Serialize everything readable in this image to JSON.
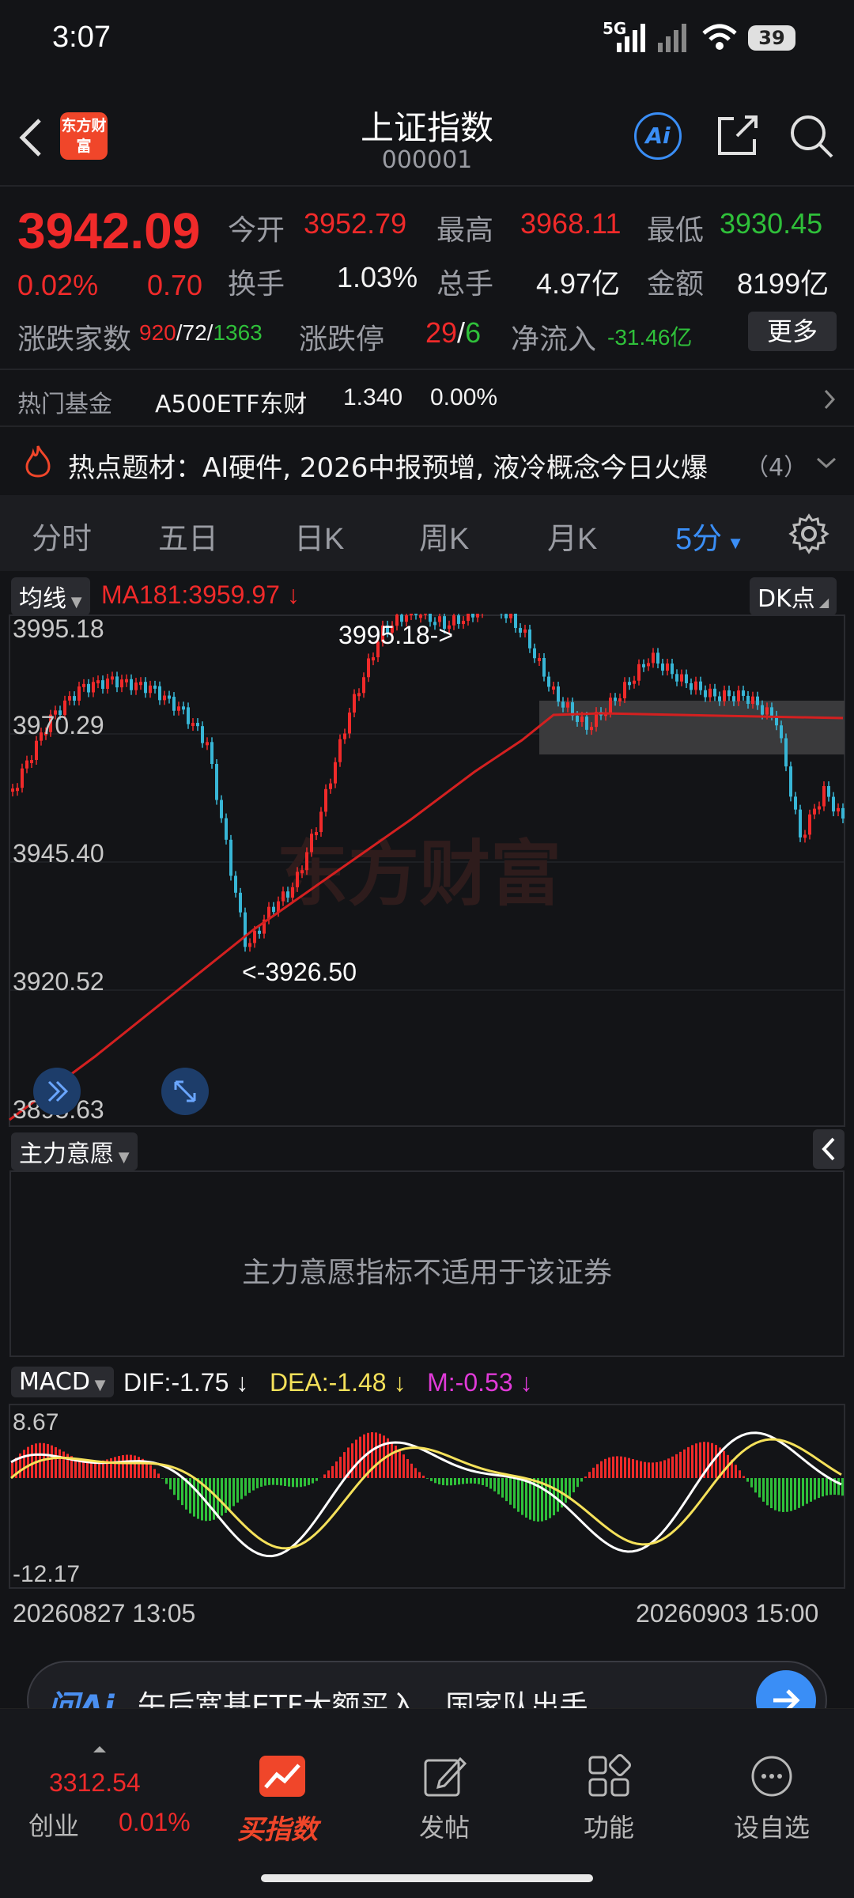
{
  "status": {
    "time": "3:07",
    "network": "5G",
    "battery": "39"
  },
  "header": {
    "title": "上证指数",
    "code": "000001",
    "logo_text": "东方财富",
    "ai_label": "Ai"
  },
  "quote": {
    "price": "3942.09",
    "change_pct": "0.02%",
    "change": "0.70",
    "open_label": "今开",
    "open": "3952.79",
    "high_label": "最高",
    "high": "3968.11",
    "low_label": "最低",
    "low": "3930.45",
    "turnover_label": "换手",
    "turnover": "1.03%",
    "volume_label": "总手",
    "volume": "4.97亿",
    "amount_label": "金额",
    "amount": "8199亿",
    "breadth_label": "涨跌家数",
    "up": "920",
    "flat": "72",
    "down": "1363",
    "limit_label": "涨跌停",
    "limit_up": "29",
    "limit_down": "6",
    "netflow_label": "净流入",
    "netflow": "-31.46亿",
    "more_label": "更多"
  },
  "fund": {
    "label": "热门基金",
    "name": "A500ETF东财",
    "price": "1.340",
    "pct": "0.00%"
  },
  "hot": {
    "label": "热点题材：",
    "text": "AI硬件, 2026中报预增, 液冷概念今日火爆",
    "count": "（4）"
  },
  "tabs": [
    "分时",
    "五日",
    "日K",
    "周K",
    "月K",
    "5分"
  ],
  "kline": {
    "indicator_label": "均线",
    "ma_text": "MA181:3959.97",
    "ma_arrow": "↓",
    "dk_label": "DK点",
    "yticks": [
      "3995.18",
      "3970.29",
      "3945.40",
      "3920.52",
      "3895.63"
    ],
    "high_annot": "3995.18->",
    "low_annot": "<-3926.50",
    "watermark": "东方财富"
  },
  "intent": {
    "label": "主力意愿",
    "message": "主力意愿指标不适用于该证券"
  },
  "macd": {
    "label": "MACD",
    "dif": "DIF:-1.75",
    "dif_arrow": "↓",
    "dea": "DEA:-1.48",
    "dea_arrow": "↓",
    "m": "M:-0.53",
    "m_arrow": "↓",
    "ymax": "8.67",
    "ymin": "-12.17",
    "start": "20260827 13:05",
    "end": "20260903 15:00"
  },
  "ask": {
    "logo": "问Ai",
    "text": "午后宽基ETF大额买入，国家队出手"
  },
  "nav": {
    "index_name": "创业",
    "index_value": "3312.54",
    "index_pct": "0.01%",
    "items": [
      "买指数",
      "发帖",
      "功能",
      "设自选"
    ]
  },
  "colors": {
    "up": "#f02a2a",
    "down": "#2fc03a",
    "ma": "#d42020",
    "dif": "#ffffff",
    "dea": "#f5e15a",
    "accent": "#3a8ef6"
  }
}
